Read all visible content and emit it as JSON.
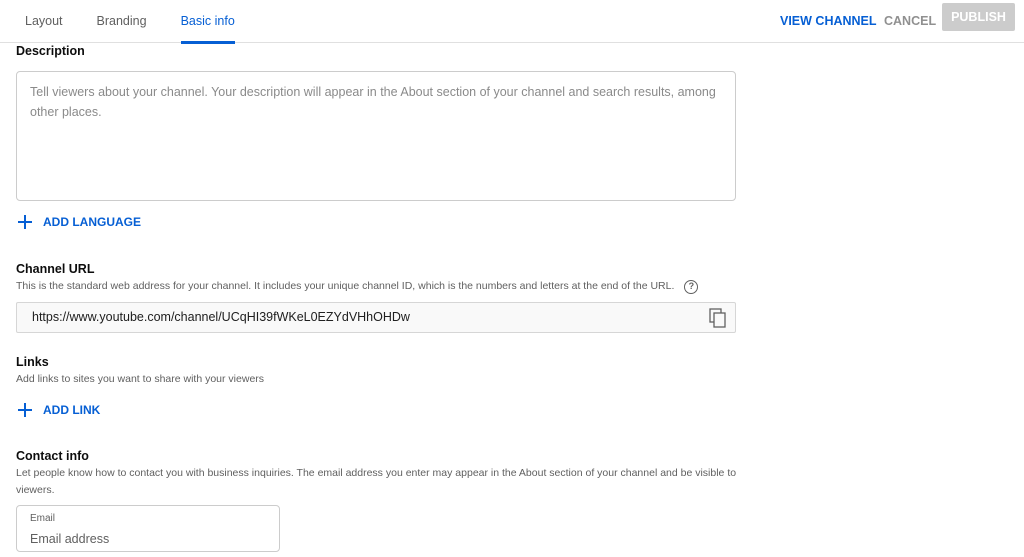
{
  "tabs": {
    "layout": "Layout",
    "branding": "Branding",
    "basic_info": "Basic info"
  },
  "actions": {
    "view_channel": "VIEW CHANNEL",
    "cancel": "CANCEL",
    "publish": "PUBLISH"
  },
  "description": {
    "title": "Description",
    "placeholder": "Tell viewers about your channel. Your description will appear in the About section of your channel and search results, among other places."
  },
  "add_language": "ADD LANGUAGE",
  "channel_url": {
    "title": "Channel URL",
    "description": "This is the standard web address for your channel. It includes your unique channel ID, which is the numbers and letters at the end of the URL.",
    "value": "https://www.youtube.com/channel/UCqHI39fWKeL0EZYdVHhOHDw"
  },
  "links": {
    "title": "Links",
    "description": "Add links to sites you want to share with your viewers",
    "add_link": "ADD LINK"
  },
  "contact": {
    "title": "Contact info",
    "description": "Let people know how to contact you with business inquiries. The email address you enter may appear in the About section of your channel and be visible to viewers.",
    "email_label": "Email",
    "email_placeholder": "Email address"
  },
  "colors": {
    "accent": "#065fd4",
    "publish_disabled": "#cccccc"
  },
  "icons": [
    "plus-icon",
    "help-icon",
    "copy-icon"
  ]
}
